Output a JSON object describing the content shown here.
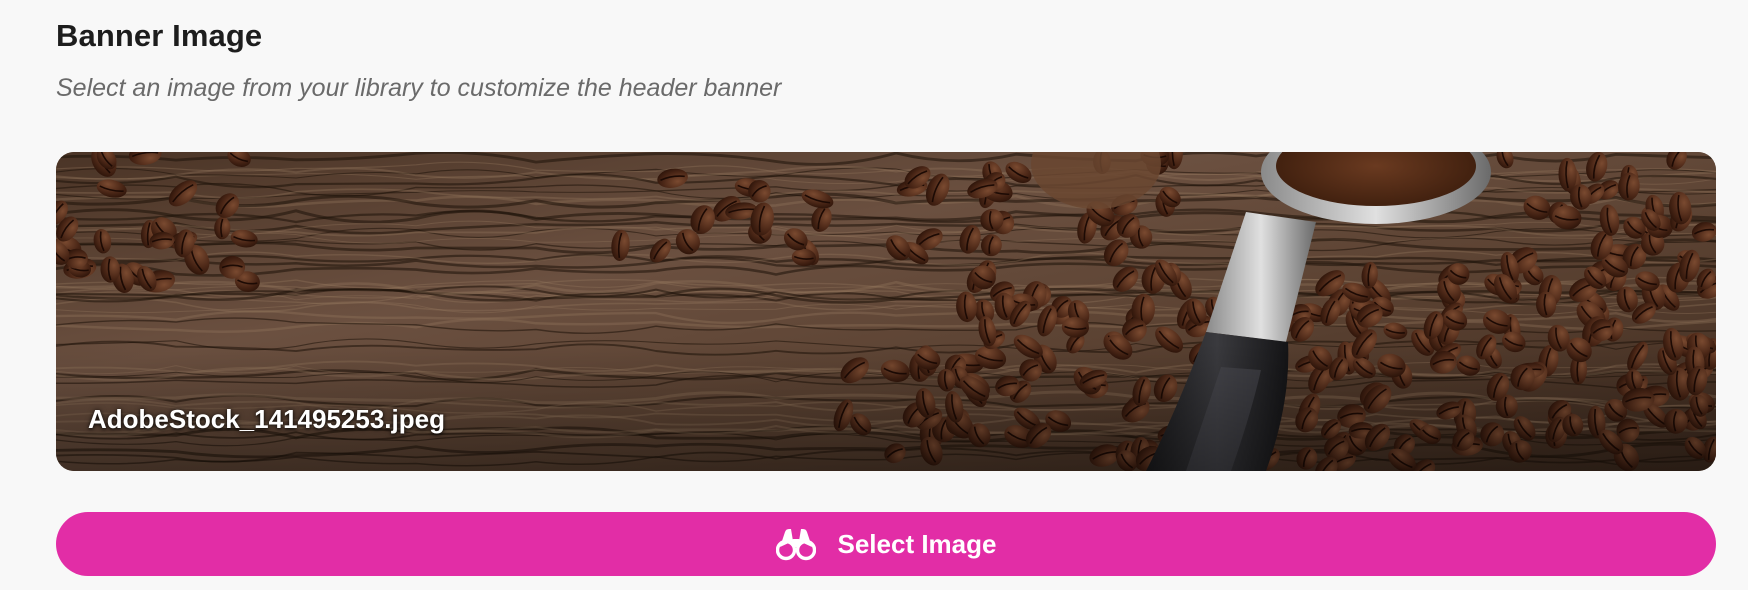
{
  "section": {
    "title": "Banner Image",
    "subtitle": "Select an image from your library to customize the header banner"
  },
  "banner": {
    "filename": "AdobeStock_141495253.jpeg",
    "image": "coffee-beans-portafilter-wood-photo"
  },
  "select_button": {
    "label": "Select Image",
    "icon": "binoculars-icon",
    "color": "#e22da6"
  }
}
